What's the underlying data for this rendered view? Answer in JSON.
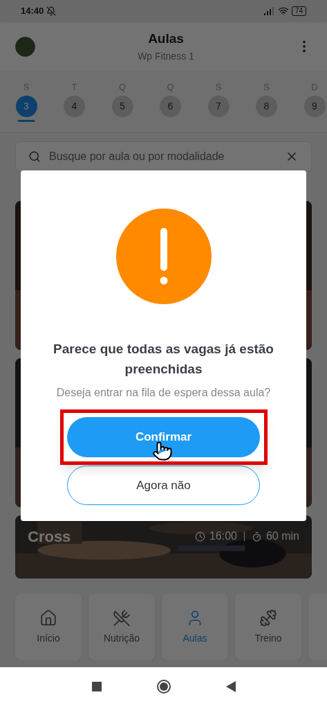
{
  "status_bar": {
    "time": "14:40",
    "battery": "74"
  },
  "header": {
    "title": "Aulas",
    "subtitle": "Wp Fitness 1"
  },
  "days": [
    {
      "letter": "S",
      "number": "3",
      "selected": true
    },
    {
      "letter": "T",
      "number": "4",
      "selected": false
    },
    {
      "letter": "Q",
      "number": "5",
      "selected": false
    },
    {
      "letter": "Q",
      "number": "6",
      "selected": false
    },
    {
      "letter": "S",
      "number": "7",
      "selected": false
    },
    {
      "letter": "S",
      "number": "8",
      "selected": false
    },
    {
      "letter": "D",
      "number": "9",
      "selected": false
    }
  ],
  "search": {
    "placeholder": "Busque por aula ou por modalidade"
  },
  "classes": [
    {
      "kind": "picture"
    },
    {
      "kind": "picture"
    },
    {
      "kind": "picture",
      "name": "Cross",
      "time": "16:00",
      "duration": "60 min"
    }
  ],
  "nav": [
    {
      "label": "Início",
      "selected": false
    },
    {
      "label": "Nutrição",
      "selected": false
    },
    {
      "label": "Aulas",
      "selected": true
    },
    {
      "label": "Treino",
      "selected": false
    }
  ],
  "dialog": {
    "title": "Parece que todas as vagas já estão preenchidas",
    "message": "Deseja entrar na fila de espera dessa aula?",
    "confirm": "Confirmar",
    "cancel": "Agora não",
    "highlighted": true
  }
}
